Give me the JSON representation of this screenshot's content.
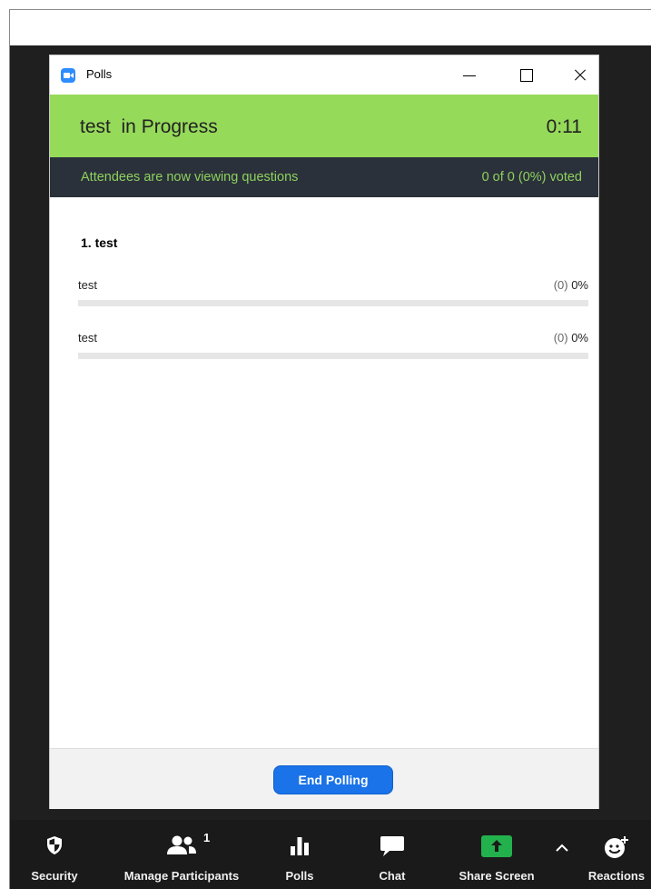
{
  "window": {
    "title": "Polls",
    "controls": {
      "minimize": "minimize",
      "maximize": "maximize",
      "close": "close"
    }
  },
  "poll": {
    "status_title": "test  in Progress",
    "timer": "0:11",
    "info_left": "Attendees are now viewing questions",
    "info_right": "0 of 0 (0%) voted",
    "question_title": "1. test",
    "answers": [
      {
        "text": "test",
        "count": "(0)",
        "percent": "0%",
        "fraction": 0
      },
      {
        "text": "test",
        "count": "(0)",
        "percent": "0%",
        "fraction": 0
      }
    ],
    "end_button": "End Polling"
  },
  "toolbar": {
    "security": "Security",
    "participants": "Manage Participants",
    "participants_count": "1",
    "polls": "Polls",
    "chat": "Chat",
    "share": "Share Screen",
    "reactions": "Reactions"
  },
  "colors": {
    "status_green": "#96da5a",
    "info_bg": "#2b313b",
    "info_text": "#8dd15c",
    "accent_blue": "#1a73e8",
    "share_green": "#23b14d"
  }
}
